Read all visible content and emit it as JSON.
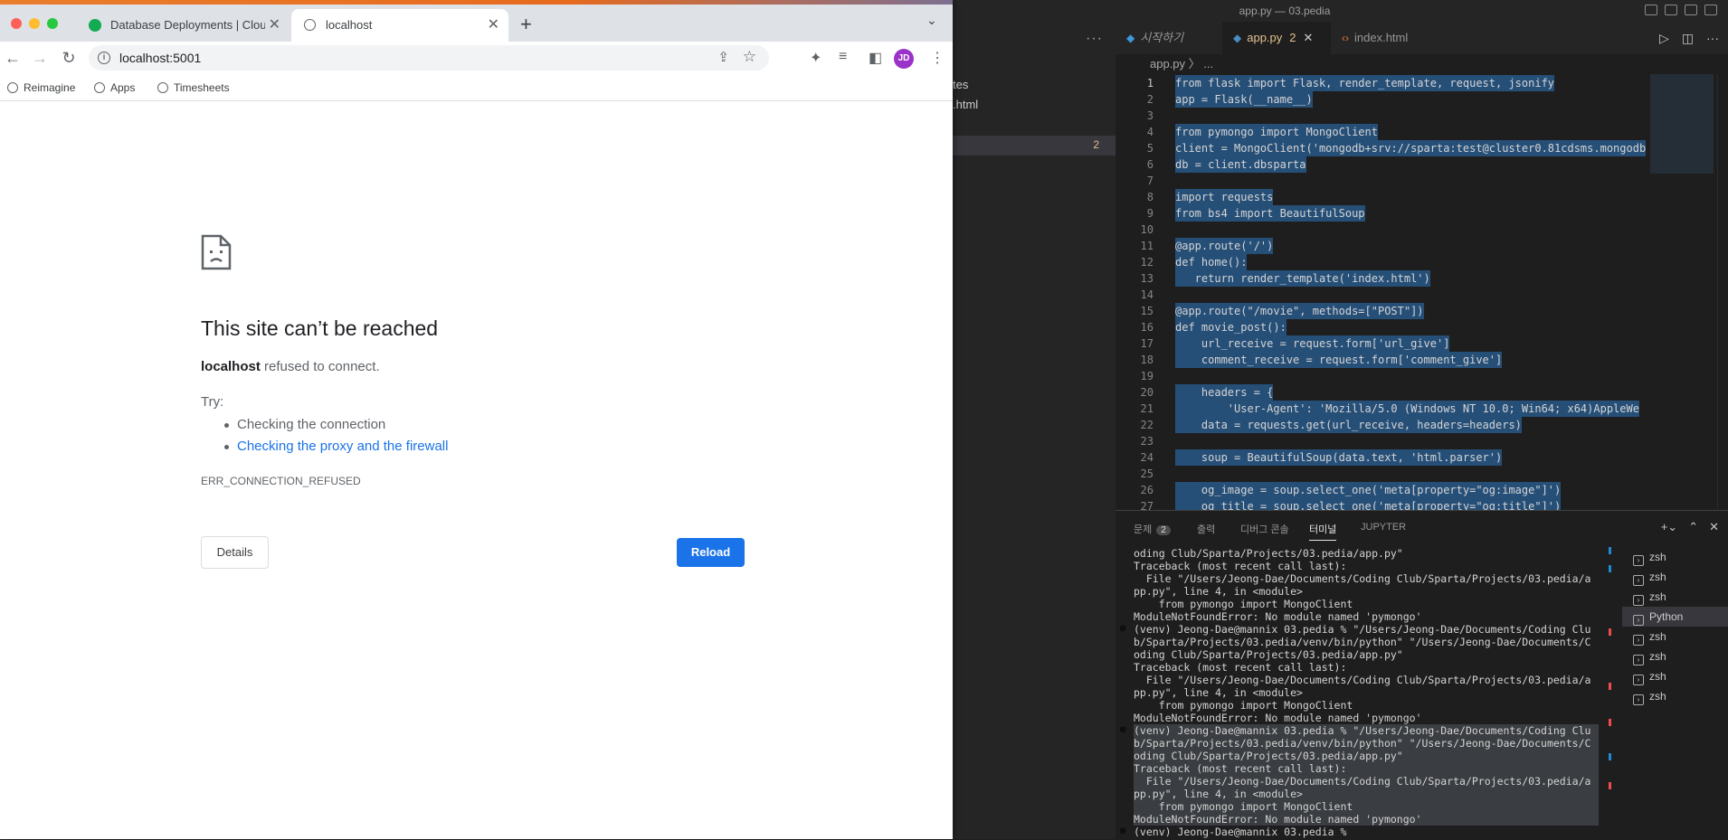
{
  "vscode": {
    "window_title": "app.py — 03.pedia",
    "sidebar": {
      "files": [
        "tes",
        ".html"
      ],
      "selected_badge": "2"
    },
    "tabs": [
      {
        "label": "시작하기"
      },
      {
        "label": "app.py",
        "count": "2"
      },
      {
        "label": "index.html"
      }
    ],
    "breadcrumb": "app.py 〉 ...",
    "code": [
      "from flask import Flask, render_template, request, jsonify",
      "app = Flask(__name__)",
      "",
      "from pymongo import MongoClient",
      "client = MongoClient('mongodb+srv://sparta:test@cluster0.81cdsms.mongodb",
      "db = client.dbsparta",
      "",
      "import requests",
      "from bs4 import BeautifulSoup",
      "",
      "@app.route('/')",
      "def home():",
      "   return render_template('index.html')",
      "",
      "@app.route(\"/movie\", methods=[\"POST\"])",
      "def movie_post():",
      "    url_receive = request.form['url_give']",
      "    comment_receive = request.form['comment_give']",
      "",
      "    headers = {",
      "        'User-Agent': 'Mozilla/5.0 (Windows NT 10.0; Win64; x64)AppleWe",
      "    data = requests.get(url_receive, headers=headers)",
      "",
      "    soup = BeautifulSoup(data.text, 'html.parser')",
      "",
      "    og_image = soup.select_one('meta[property=\"og:image\"]')",
      "    og_title = soup.select_one('meta[property=\"og:title\"]')"
    ],
    "panel_tabs": [
      {
        "label": "문제",
        "badge": "2"
      },
      {
        "label": "출력"
      },
      {
        "label": "디버그 콘솔"
      },
      {
        "label": "터미널"
      },
      {
        "label": "JUPYTER"
      }
    ],
    "terminal": [
      "oding Club/Sparta/Projects/03.pedia/app.py\"",
      "Traceback (most recent call last):",
      "  File \"/Users/Jeong-Dae/Documents/Coding Club/Sparta/Projects/03.pedia/a",
      "pp.py\", line 4, in <module>",
      "    from pymongo import MongoClient",
      "ModuleNotFoundError: No module named 'pymongo'",
      "(venv) Jeong-Dae@mannix 03.pedia % \"/Users/Jeong-Dae/Documents/Coding Clu",
      "b/Sparta/Projects/03.pedia/venv/bin/python\" \"/Users/Jeong-Dae/Documents/C",
      "oding Club/Sparta/Projects/03.pedia/app.py\"",
      "Traceback (most recent call last):",
      "  File \"/Users/Jeong-Dae/Documents/Coding Club/Sparta/Projects/03.pedia/a",
      "pp.py\", line 4, in <module>",
      "    from pymongo import MongoClient",
      "ModuleNotFoundError: No module named 'pymongo'",
      "(venv) Jeong-Dae@mannix 03.pedia % \"/Users/Jeong-Dae/Documents/Coding Clu",
      "b/Sparta/Projects/03.pedia/venv/bin/python\" \"/Users/Jeong-Dae/Documents/C",
      "oding Club/Sparta/Projects/03.pedia/app.py\"",
      "Traceback (most recent call last):",
      "  File \"/Users/Jeong-Dae/Documents/Coding Club/Sparta/Projects/03.pedia/a",
      "pp.py\", line 4, in <module>",
      "    from pymongo import MongoClient",
      "ModuleNotFoundError: No module named 'pymongo'",
      "(venv) Jeong-Dae@mannix 03.pedia % "
    ],
    "terminal_list": [
      "zsh",
      "zsh",
      "zsh",
      "Python",
      "zsh",
      "zsh",
      "zsh",
      "zsh"
    ]
  },
  "chrome": {
    "tabs": [
      {
        "label": "Database Deployments | Cloud"
      },
      {
        "label": "localhost"
      }
    ],
    "url": "localhost:5001",
    "avatar": "JD",
    "bookmarks": [
      "Reimagine",
      "Apps",
      "Timesheets"
    ]
  },
  "error_page": {
    "title": "This site can’t be reached",
    "host": "localhost",
    "desc_rest": "refused to connect.",
    "try_label": "Try:",
    "suggestions": [
      "Checking the connection",
      "Checking the proxy and the firewall"
    ],
    "code": "ERR_CONNECTION_REFUSED",
    "details_label": "Details",
    "reload_label": "Reload"
  }
}
